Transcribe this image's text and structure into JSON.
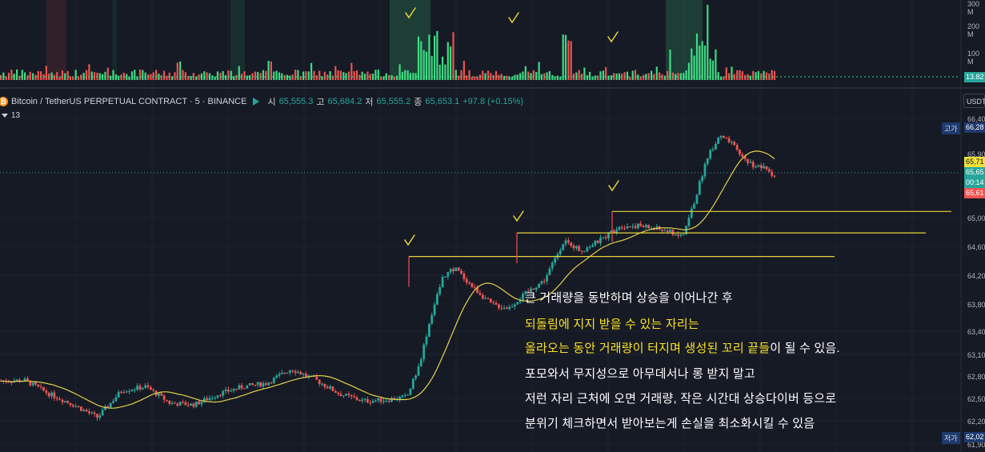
{
  "header": {
    "symbol": "Bitcoin / TetherUS PERPETUAL CONTRACT · 5 · BINANCE",
    "open_label": "시",
    "open": "65,555.3",
    "high_label": "고",
    "high": "65,684.2",
    "low_label": "저",
    "low": "65,555.2",
    "close_label": "종",
    "close": "65,653.1",
    "change": "+97.8 (+0.15%)",
    "indicator": "13",
    "currency": "USDT"
  },
  "volume_axis": {
    "ticks": [
      "300 M",
      "200 M",
      "100 M"
    ],
    "current": "13.82"
  },
  "price_axis": {
    "ticks": [
      "66,40",
      "65,90",
      "65,00",
      "64,60",
      "64,20",
      "63,80",
      "63,40",
      "63,10",
      "62,80",
      "62,50",
      "62,20",
      "61,90"
    ],
    "high_tag": {
      "label": "고가",
      "value": "66,28"
    },
    "low_tag": {
      "label": "저가",
      "value": "62,02"
    },
    "ma_tag": "65,71",
    "last_tag": "65,65",
    "countdown": "00:14",
    "red_tag": "65,61"
  },
  "annotation": {
    "line1": "큰 거래량을 동반하며 상승을 이어나간 후",
    "line2_hl": "되돌림에 지지 받을 수 있는 자리는",
    "line3_hl": "올라오는 동안 거래량이 터지며 생성된 꼬리 끝들",
    "line3_rest": "이 될 수 있음.",
    "line4": "포모와서 무지성으로 아무데서나 롱 받지 말고",
    "line5": "저런 자리 근처에 오면 거래량, 작은 시간대 상승다이버 등으로",
    "line6": "분위기 체크하면서 받아보는게 손실을 최소화시킬 수 있음"
  },
  "colors": {
    "up": "#26a69a",
    "down": "#ef5350",
    "vol_up": "#3ddc84",
    "vol_down": "#ef5350",
    "ma": "#e3d14a",
    "level": "#e6d33a",
    "check": "#e6d33a",
    "bg": "#161a25"
  },
  "chart_data": {
    "type": "candlestick",
    "series": [
      {
        "name": "BTCUSDT.P 5m",
        "values": []
      }
    ],
    "ylim": [
      61900,
      66450
    ],
    "support_levels": [
      64520,
      64850,
      65150
    ],
    "candle_count": 290,
    "high": 66280,
    "low": 62020
  }
}
